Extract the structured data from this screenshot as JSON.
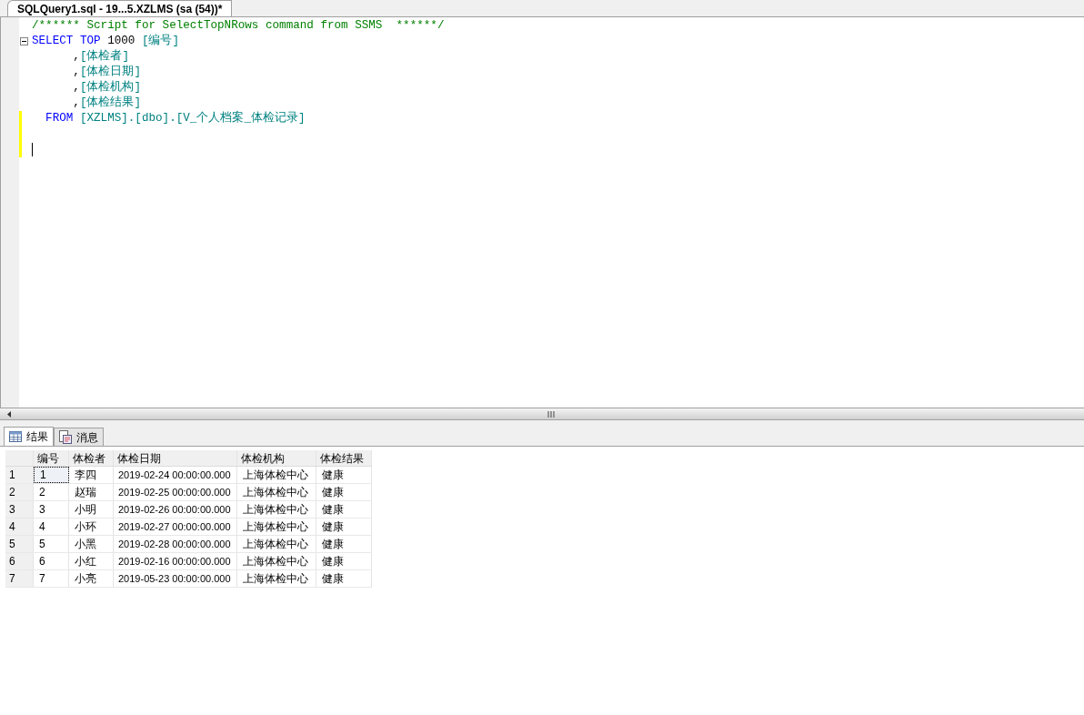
{
  "doc_tab": {
    "title": "SQLQuery1.sql - 19...5.XZLMS (sa (54))*",
    "selected": true
  },
  "code_lines": [
    {
      "segments": [
        {
          "kind": "comment",
          "text": "/****** Script for SelectTopNRows command from SSMS  ******/"
        }
      ],
      "changed": false
    },
    {
      "segments": [
        {
          "kind": "keyword",
          "text": "SELECT TOP "
        },
        {
          "kind": "plain",
          "text": "1000 "
        },
        {
          "kind": "ident",
          "text": "[编号]"
        }
      ],
      "changed": false,
      "fold": true
    },
    {
      "segments": [
        {
          "kind": "plain",
          "text": "      ,"
        },
        {
          "kind": "ident",
          "text": "[体检者]"
        }
      ],
      "changed": false
    },
    {
      "segments": [
        {
          "kind": "plain",
          "text": "      ,"
        },
        {
          "kind": "ident",
          "text": "[体检日期]"
        }
      ],
      "changed": false
    },
    {
      "segments": [
        {
          "kind": "plain",
          "text": "      ,"
        },
        {
          "kind": "ident",
          "text": "[体检机构]"
        }
      ],
      "changed": false
    },
    {
      "segments": [
        {
          "kind": "plain",
          "text": "      ,"
        },
        {
          "kind": "ident",
          "text": "[体检结果]"
        }
      ],
      "changed": false
    },
    {
      "segments": [
        {
          "kind": "keyword",
          "text": "  FROM "
        },
        {
          "kind": "ident",
          "text": "[XZLMS].[dbo].[V_个人档案_体检记录]"
        }
      ],
      "changed": true
    },
    {
      "changed": true
    },
    {
      "changed": true,
      "cursor": true
    }
  ],
  "result_tabs": [
    {
      "label": "结果",
      "kind": "grid",
      "selected": true
    },
    {
      "label": "消息",
      "kind": "messages",
      "selected": false
    }
  ],
  "table": {
    "columns": [
      "编号",
      "体检者",
      "体检日期",
      "体检机构",
      "体检结果"
    ],
    "rows": [
      {
        "row_number": "1",
        "cells": [
          "1",
          "李四",
          "2019-02-24 00:00:00.000",
          "上海体检中心",
          "健康"
        ],
        "focused": true
      },
      {
        "row_number": "2",
        "cells": [
          "2",
          "赵瑞",
          "2019-02-25 00:00:00.000",
          "上海体检中心",
          "健康"
        ],
        "focused": false
      },
      {
        "row_number": "3",
        "cells": [
          "3",
          "小明",
          "2019-02-26 00:00:00.000",
          "上海体检中心",
          "健康"
        ],
        "focused": false
      },
      {
        "row_number": "4",
        "cells": [
          "4",
          "小环",
          "2019-02-27 00:00:00.000",
          "上海体检中心",
          "健康"
        ],
        "focused": false
      },
      {
        "row_number": "5",
        "cells": [
          "5",
          "小黑",
          "2019-02-28 00:00:00.000",
          "上海体检中心",
          "健康"
        ],
        "focused": false
      },
      {
        "row_number": "6",
        "cells": [
          "6",
          "小红",
          "2019-02-16 00:00:00.000",
          "上海体检中心",
          "健康"
        ],
        "focused": false
      },
      {
        "row_number": "7",
        "cells": [
          "7",
          "小亮",
          "2019-05-23 00:00:00.000",
          "上海体检中心",
          "健康"
        ],
        "focused": false
      }
    ]
  }
}
